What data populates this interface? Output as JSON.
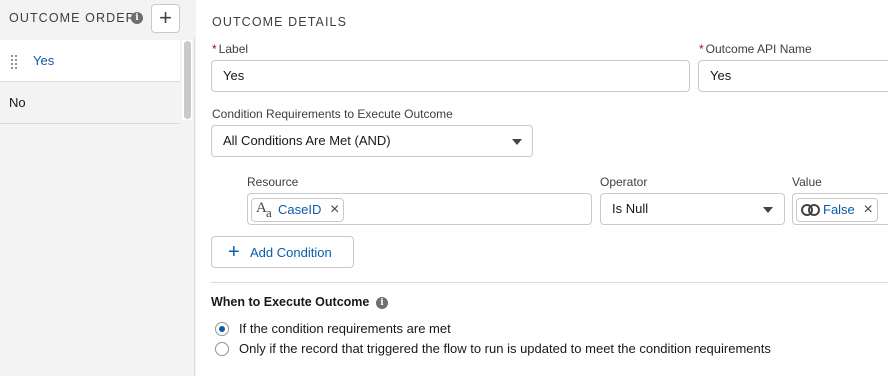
{
  "outcome_order": {
    "title": "OUTCOME ORDER",
    "add_icon": "plus-icon",
    "outcomes": [
      {
        "label": "Yes",
        "selected": true
      },
      {
        "label": "No",
        "selected": false
      }
    ]
  },
  "details": {
    "section_title": "OUTCOME DETAILS",
    "label_field": {
      "label": "Label",
      "value": "Yes",
      "required": true
    },
    "api_name_field": {
      "label": "Outcome API Name",
      "value": "Yes",
      "required": true
    },
    "condition_requirements": {
      "label": "Condition Requirements to Execute Outcome",
      "selected": "All Conditions Are Met (AND)"
    },
    "condition": {
      "resource_label": "Resource",
      "resource_value": "CaseID",
      "resource_icon": "text-type-icon",
      "operator_label": "Operator",
      "operator_value": "Is Null",
      "value_label": "Value",
      "value_value": "False",
      "value_icon": "boolean-icon"
    },
    "add_condition_label": "Add Condition",
    "when_to_execute": {
      "title": "When to Execute Outcome",
      "options": [
        {
          "label": "If the condition requirements are met",
          "checked": true
        },
        {
          "label": "Only if the record that triggered the flow to run is updated to meet the condition requirements",
          "checked": false
        }
      ]
    }
  },
  "colors": {
    "accent": "#0b5cab",
    "required": "#ba0517",
    "border": "#c9c9c9",
    "panel_bg": "#f3f3f3"
  }
}
